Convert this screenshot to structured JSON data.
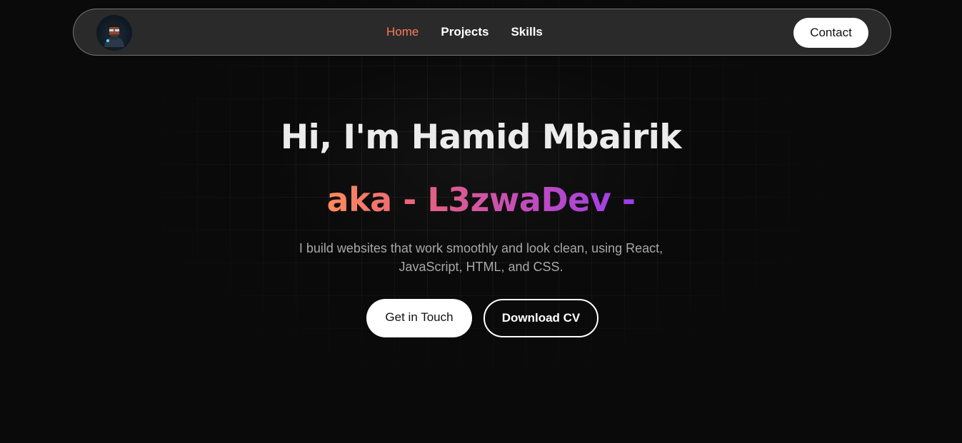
{
  "nav": {
    "avatar_icon": "developer-avatar-icon",
    "links": [
      {
        "label": "Home",
        "active": true
      },
      {
        "label": "Projects",
        "active": false
      },
      {
        "label": "Skills",
        "active": false
      }
    ],
    "contact_label": "Contact",
    "active_color": "#ff7a5c"
  },
  "hero": {
    "title": "Hi, I'm Hamid Mbairik",
    "subtitle": "aka - L3zwaDev -",
    "description": "I build websites that work smoothly and look clean, using React, JavaScript, HTML, and CSS.",
    "primary_button": "Get in Touch",
    "secondary_button": "Download CV",
    "gradient_colors": [
      "#ff8a5c",
      "#e8627e",
      "#c64fb4",
      "#9b3df0"
    ]
  }
}
